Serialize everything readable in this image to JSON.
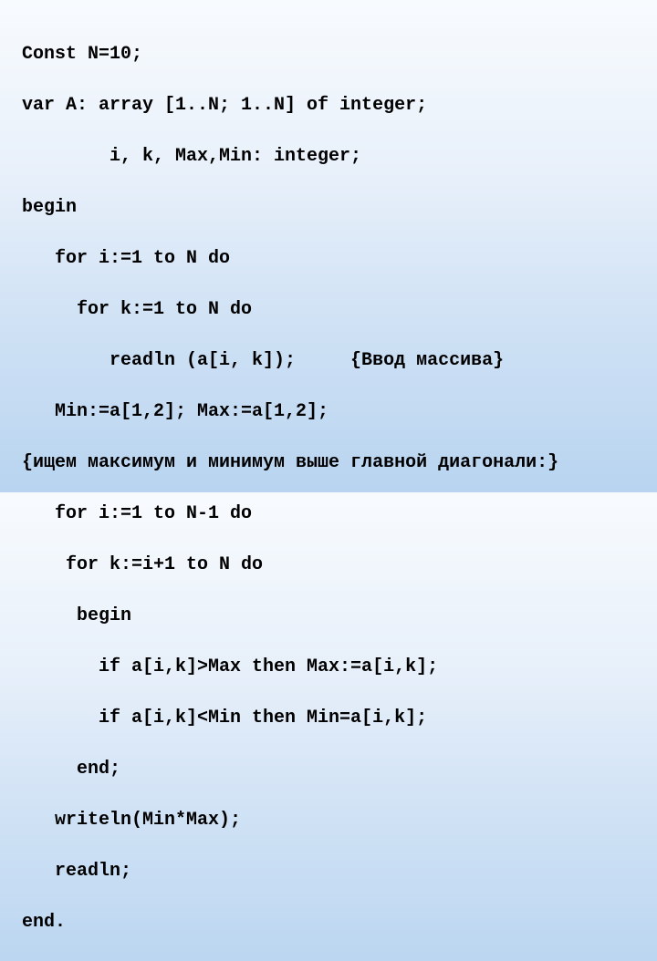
{
  "code": {
    "lines": [
      "Const N=10;",
      "var A: array [1..N; 1..N] of integer;",
      "        i, k, Max,Min: integer;",
      "begin",
      "   for i:=1 to N do",
      "     for k:=1 to N do",
      "        readln (a[i, k]);     {Ввод массива}",
      "   Min:=a[1,2]; Max:=a[1,2];",
      "{ищем максимум и минимум выше главной диагонали:}",
      "   for i:=1 to N-1 do",
      "    for k:=i+1 to N do",
      "     begin",
      "       if a[i,k]>Max then Max:=a[i,k];",
      "       if a[i,k]<Min then Min=a[i,k];",
      "     end;",
      "   writeln(Min*Max);",
      "   readln;",
      "end."
    ]
  }
}
